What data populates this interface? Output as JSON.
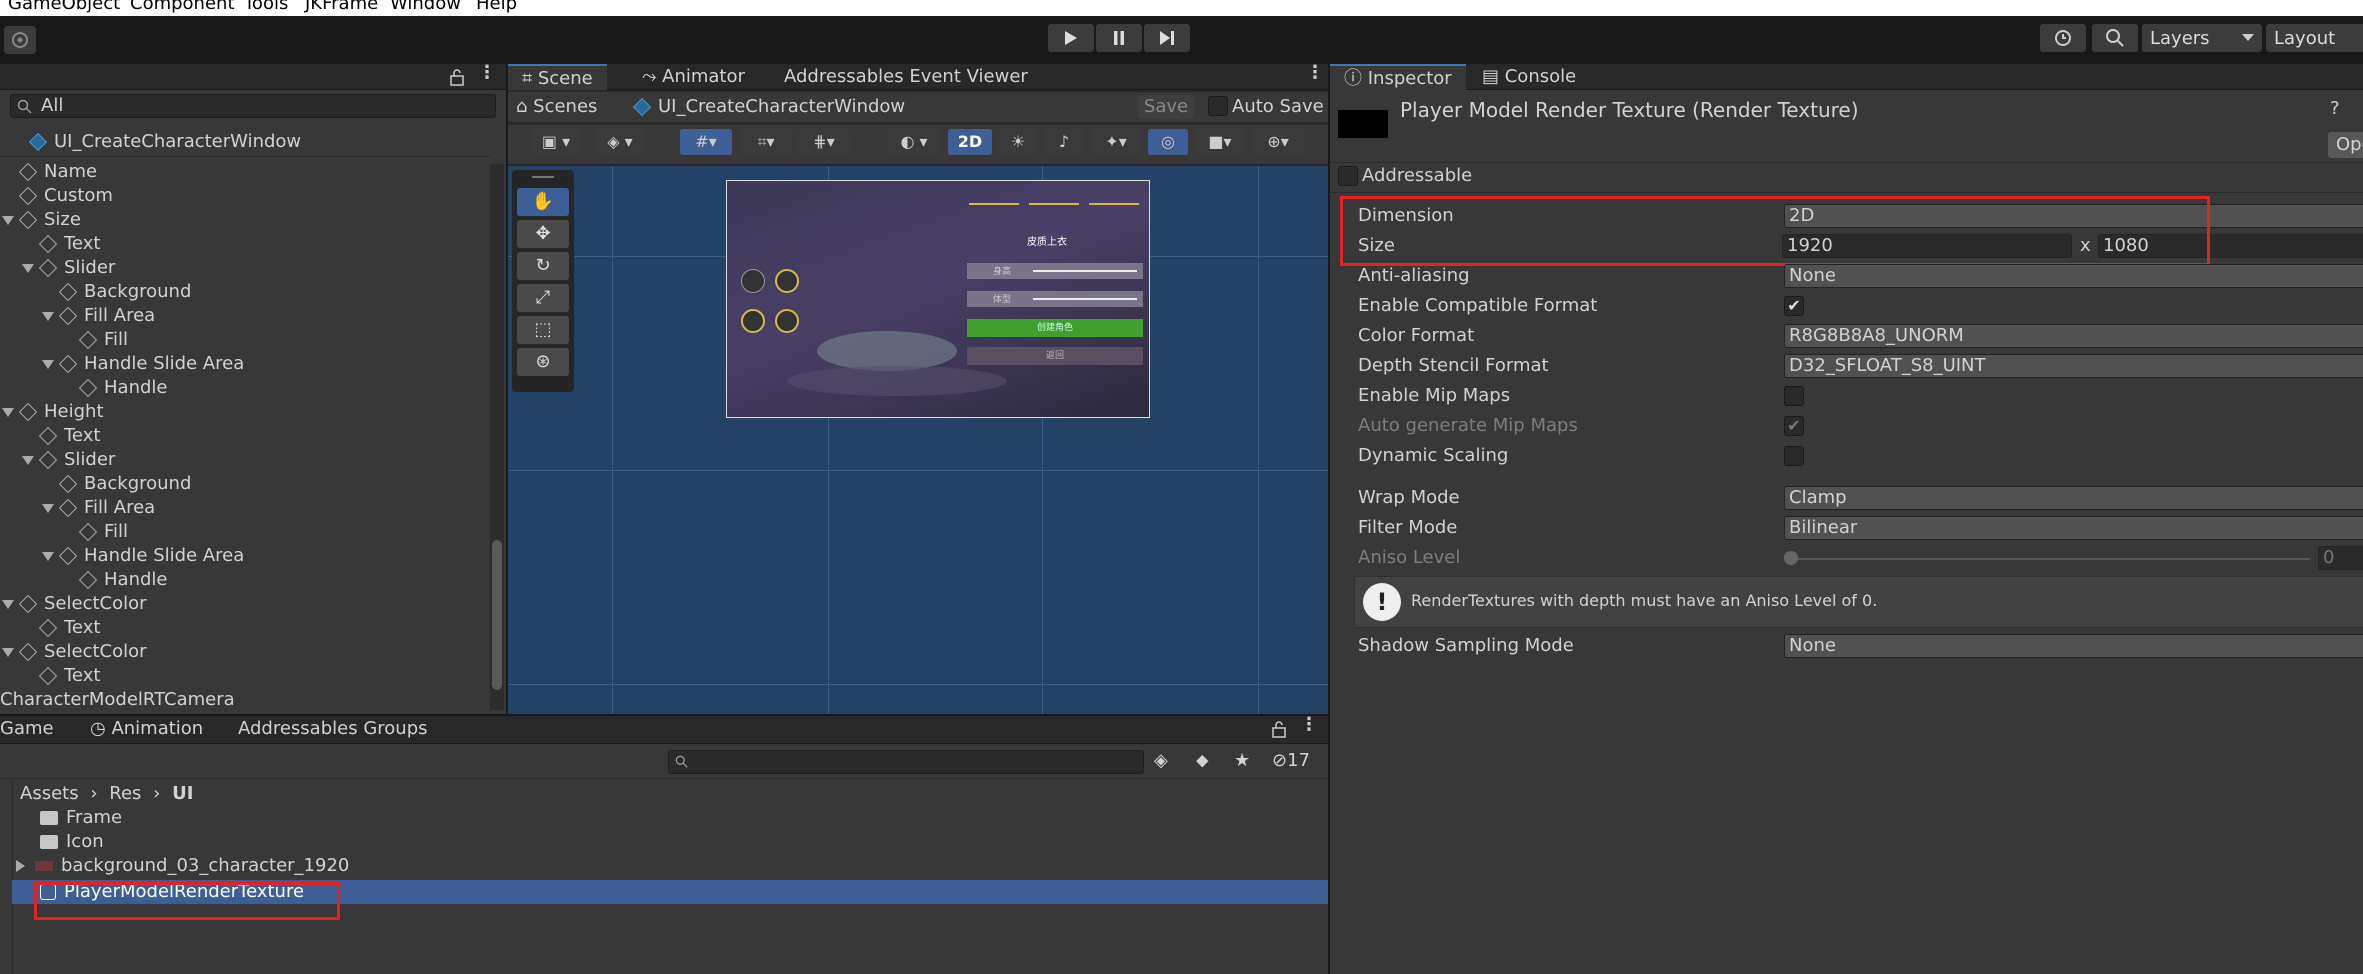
{
  "menu": {
    "items": [
      "GameObject",
      "Component",
      "Tools",
      "JKFrame",
      "Window",
      "Help"
    ]
  },
  "toolbar": {
    "layers_label": "Layers",
    "layout_label": "Layout"
  },
  "hierarchy": {
    "search_placeholder": "All",
    "scene_name": "UI_CreateCharacterWindow",
    "rows": [
      {
        "label": "Name",
        "indent": 0,
        "arrow": false
      },
      {
        "label": "Custom",
        "indent": 0,
        "arrow": false
      },
      {
        "label": "Size",
        "indent": 0,
        "arrow": true
      },
      {
        "label": "Text",
        "indent": 1,
        "arrow": false
      },
      {
        "label": "Slider",
        "indent": 1,
        "arrow": true
      },
      {
        "label": "Background",
        "indent": 2,
        "arrow": false
      },
      {
        "label": "Fill Area",
        "indent": 2,
        "arrow": true
      },
      {
        "label": "Fill",
        "indent": 3,
        "arrow": false
      },
      {
        "label": "Handle Slide Area",
        "indent": 2,
        "arrow": true
      },
      {
        "label": "Handle",
        "indent": 3,
        "arrow": false
      },
      {
        "label": "Height",
        "indent": 0,
        "arrow": true
      },
      {
        "label": "Text",
        "indent": 1,
        "arrow": false
      },
      {
        "label": "Slider",
        "indent": 1,
        "arrow": true
      },
      {
        "label": "Background",
        "indent": 2,
        "arrow": false
      },
      {
        "label": "Fill Area",
        "indent": 2,
        "arrow": true
      },
      {
        "label": "Fill",
        "indent": 3,
        "arrow": false
      },
      {
        "label": "Handle Slide Area",
        "indent": 2,
        "arrow": true
      },
      {
        "label": "Handle",
        "indent": 3,
        "arrow": false
      },
      {
        "label": "SelectColor",
        "indent": 0,
        "arrow": true
      },
      {
        "label": "Text",
        "indent": 1,
        "arrow": false
      },
      {
        "label": "SelectColor",
        "indent": 0,
        "arrow": true
      },
      {
        "label": "Text",
        "indent": 1,
        "arrow": false
      },
      {
        "label": "CharacterModelRTCamera",
        "indent": -1,
        "arrow": false
      }
    ]
  },
  "scene": {
    "tabs": {
      "scene": "Scene",
      "animator": "Animator",
      "events": "Addressables Event Viewer"
    },
    "breadcrumb_root": "Scenes",
    "breadcrumb_prefab": "UI_CreateCharacterWindow",
    "save_label": "Save",
    "autosave_label": "Auto Save",
    "mode_2d": "2D",
    "preview_text": {
      "option_label": "皮质上衣",
      "btn_green": "创建角色",
      "btn_grey": "返回",
      "slider1": "身高",
      "slider2": "体型"
    }
  },
  "inspector": {
    "tab_label": "Inspector",
    "console_label": "Console",
    "asset_title": "Player Model Render Texture (Render Texture)",
    "open_label": "Ope",
    "addressable_label": "Addressable",
    "props": {
      "dimension": {
        "label": "Dimension",
        "value": "2D"
      },
      "size": {
        "label": "Size",
        "width": "1920",
        "x": "x",
        "height": "1080"
      },
      "antialiasing": {
        "label": "Anti-aliasing",
        "value": "None"
      },
      "compatible": {
        "label": "Enable Compatible Format",
        "checked": true
      },
      "color_format": {
        "label": "Color Format",
        "value": "R8G8B8A8_UNORM"
      },
      "depth_format": {
        "label": "Depth Stencil Format",
        "value": "D32_SFLOAT_S8_UINT"
      },
      "mipmaps": {
        "label": "Enable Mip Maps",
        "checked": false
      },
      "auto_mip": {
        "label": "Auto generate Mip Maps",
        "checked": true
      },
      "dynamic_scaling": {
        "label": "Dynamic Scaling",
        "checked": false
      },
      "wrap_mode": {
        "label": "Wrap Mode",
        "value": "Clamp"
      },
      "filter_mode": {
        "label": "Filter Mode",
        "value": "Bilinear"
      },
      "aniso": {
        "label": "Aniso Level",
        "value": "0"
      },
      "warning": "RenderTextures with depth must have an Aniso Level of 0.",
      "shadow": {
        "label": "Shadow Sampling Mode",
        "value": "None"
      }
    }
  },
  "project": {
    "tabs": {
      "game": "Game",
      "animation": "Animation",
      "addr_groups": "Addressables Groups"
    },
    "count": "17",
    "breadcrumb": [
      "Assets",
      "Res",
      "UI"
    ],
    "items": [
      {
        "label": "Frame",
        "type": "folder"
      },
      {
        "label": "Icon",
        "type": "folder"
      },
      {
        "label": "background_03_character_1920",
        "type": "texture"
      },
      {
        "label": "PlayerModelRenderTexture",
        "type": "rendertexture",
        "selected": true
      }
    ]
  },
  "colors": {
    "accent": "#3a79bb",
    "selection": "#3e5f96",
    "highlight_box": "#e52222",
    "scene_bg": "#244266"
  }
}
